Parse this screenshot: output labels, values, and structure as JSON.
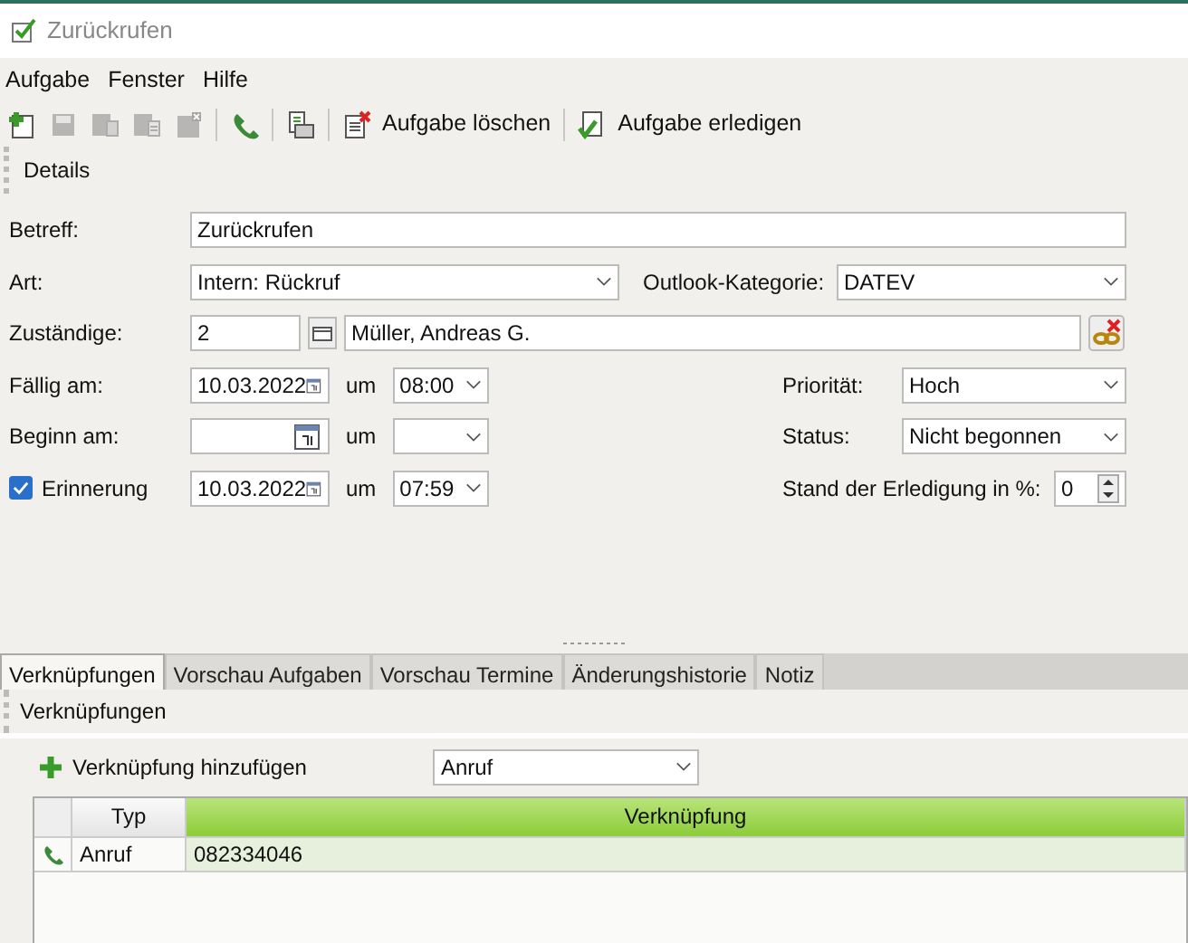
{
  "window": {
    "title": "Zurückrufen"
  },
  "menu": [
    "Aufgabe",
    "Fenster",
    "Hilfe"
  ],
  "toolbar": [
    {
      "kind": "new",
      "disabled": false
    },
    {
      "kind": "save",
      "disabled": true
    },
    {
      "kind": "save-copy",
      "disabled": true
    },
    {
      "kind": "save-list",
      "disabled": true
    },
    {
      "kind": "save-close",
      "disabled": true
    },
    {
      "kind": "sep"
    },
    {
      "kind": "phone",
      "disabled": false
    },
    {
      "kind": "sep"
    },
    {
      "kind": "print",
      "disabled": false
    },
    {
      "kind": "sep"
    },
    {
      "kind": "delete",
      "label": "Aufgabe löschen",
      "disabled": false
    },
    {
      "kind": "sep"
    },
    {
      "kind": "done",
      "label": "Aufgabe erledigen",
      "disabled": false
    }
  ],
  "details_header": "Details",
  "form": {
    "subject": {
      "label": "Betreff:",
      "value": "Zurückrufen"
    },
    "type": {
      "label": "Art:",
      "value": "Intern: Rückruf"
    },
    "category": {
      "label": "Outlook-Kategorie:",
      "value": "DATEV"
    },
    "assignee": {
      "label": "Zuständige:",
      "number": "2",
      "name": "Müller, Andreas G."
    },
    "due": {
      "label": "Fällig am:",
      "date": "10.03.2022",
      "um": "um",
      "time": "08:00"
    },
    "start": {
      "label": "Beginn am:",
      "um": "um"
    },
    "reminder": {
      "label": "Erinnerung",
      "checked": true,
      "date": "10.03.2022",
      "um": "um",
      "time": "07:59"
    },
    "priority": {
      "label": "Priorität:",
      "value": "Hoch"
    },
    "status": {
      "label": "Status:",
      "value": "Nicht begonnen"
    },
    "progress": {
      "label": "Stand der Erledigung in %:",
      "value": "0"
    }
  },
  "tabs": [
    {
      "label": "Verknüpfungen",
      "selected": true
    },
    {
      "label": "Vorschau Aufgaben",
      "selected": false
    },
    {
      "label": "Vorschau Termine",
      "selected": false
    },
    {
      "label": "Änderungshistorie",
      "selected": false
    },
    {
      "label": "Notiz",
      "selected": false
    }
  ],
  "links": {
    "header": "Verknüpfungen",
    "add_label": "Verknüpfung hinzufügen",
    "add_type": "Anruf",
    "columns": [
      "Typ",
      "Verknüpfung"
    ],
    "rows": [
      {
        "type": "Anruf",
        "link": "082334046"
      }
    ]
  }
}
